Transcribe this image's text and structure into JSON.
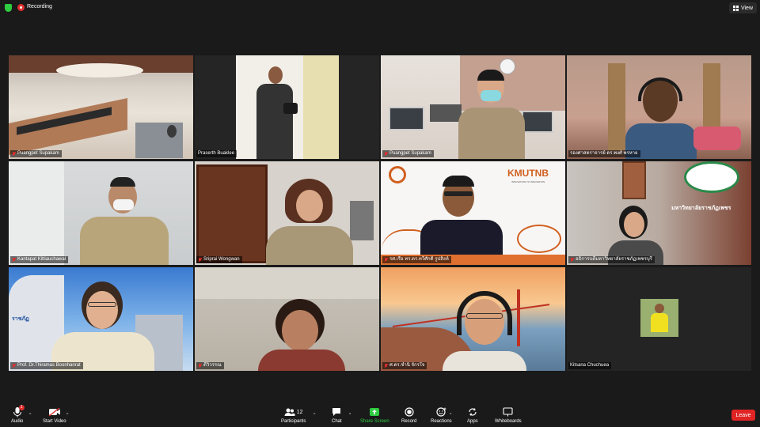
{
  "topbar": {
    "recording_label": "Recording",
    "view_label": "View"
  },
  "tiles": [
    {
      "name": "Puangpet Supakam",
      "muted": true
    },
    {
      "name": "Praserth Buaklee",
      "muted": false
    },
    {
      "name": "Puangpet Supakam",
      "muted": true
    },
    {
      "name": "รองศาสตราจารย์ ดร.พงศ์ พรหาย",
      "muted": false
    },
    {
      "name": "Kantapat Kittiauchawal",
      "muted": true
    },
    {
      "name": "Sriprai Wongwan",
      "muted": true
    },
    {
      "name": "รศ.เรือ ทร.ดร.ทวีศักดิ์ รูปสิงห์",
      "muted": true
    },
    {
      "name": "อธิการบดีมหาวิทยาลัยราชภัฏเพชรบุรี",
      "muted": true
    },
    {
      "name": "Prof. Dr.Thiramas Boonhanrat",
      "muted": true
    },
    {
      "name": "ดีวิวรรณ",
      "muted": true
    },
    {
      "name": "ศ.ดร.ชำนิ จักรใจ",
      "muted": true
    },
    {
      "name": "Kitsana Chuchuea",
      "muted": false
    }
  ],
  "tile_texts": {
    "kmutnb_logo": "KMUTNB",
    "kmutnb_tagline": "INNOVATION TO INNOVATION",
    "univ_sign": "มหาวิทยาลัยราชภัฏเพชร",
    "building_sign": "ราชภัฏ"
  },
  "toolbar": {
    "audio": "Audio",
    "start_video": "Start Video",
    "participants": "Participants",
    "participants_count": "12",
    "chat": "Chat",
    "share_screen": "Share Screen",
    "record": "Record",
    "reactions": "Reactions",
    "apps": "Apps",
    "whiteboards": "Whiteboards",
    "leave": "Leave",
    "audio_badge": "1"
  },
  "colors": {
    "active_speaker": "#b6d84a",
    "leave": "#e02424",
    "share": "#2ecc40",
    "recording": "#e02e2e"
  }
}
